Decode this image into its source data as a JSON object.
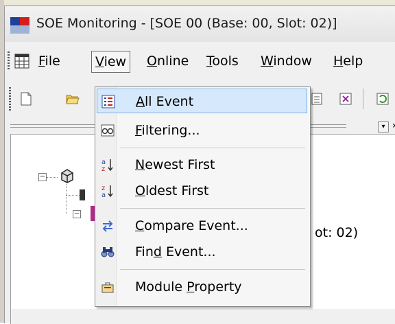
{
  "window": {
    "title": "SOE Monitoring - [SOE 00 (Base: 00, Slot: 02)]"
  },
  "menubar": {
    "items": [
      {
        "mnemonic": "F",
        "rest": "ile"
      },
      {
        "mnemonic": "V",
        "rest": "iew"
      },
      {
        "mnemonic": "O",
        "rest": "nline"
      },
      {
        "mnemonic": "T",
        "rest": "ools"
      },
      {
        "mnemonic": "W",
        "rest": "indow"
      },
      {
        "mnemonic": "H",
        "rest": "elp"
      }
    ]
  },
  "view_menu": {
    "items": [
      {
        "pre": "",
        "mnemonic": "A",
        "post": "ll Event",
        "icon": "list-icon",
        "highlighted": true
      },
      {
        "pre": "",
        "mnemonic": "F",
        "post": "iltering...",
        "icon": "glasses-icon"
      },
      {
        "pre": "",
        "mnemonic": "N",
        "post": "ewest First",
        "icon": "sort-az-icon"
      },
      {
        "pre": "",
        "mnemonic": "O",
        "post": "ldest First",
        "icon": "sort-za-icon"
      },
      {
        "pre": "",
        "mnemonic": "C",
        "post": "ompare Event...",
        "icon": "compare-arrows-icon"
      },
      {
        "pre": "Fin",
        "mnemonic": "d",
        "post": " Event...",
        "icon": "binoculars-icon"
      },
      {
        "pre": "Module ",
        "mnemonic": "P",
        "post": "roperty",
        "icon": "module-icon"
      }
    ]
  },
  "tree": {
    "visible_fragment": "ot: 02)"
  },
  "colors": {
    "highlight_bg": "#d6e8fb",
    "highlight_border": "#7ab0e8",
    "window_bg": "#f0f0f0"
  }
}
